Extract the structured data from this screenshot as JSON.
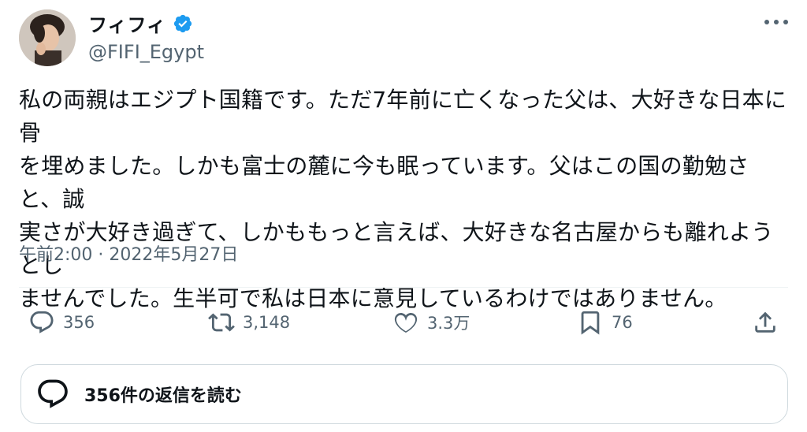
{
  "author": {
    "display_name": "フィフィ",
    "handle": "@FIFI_Egypt",
    "verified": true,
    "verified_color": "#1d9bf0"
  },
  "tweet": {
    "text": "私の両親はエジプト国籍です。ただ7年前に亡くなった父は、大好きな日本に骨\nを埋めました。しかも富士の麓に今も眠っています。父はこの国の勤勉さと、誠\n実さが大好き過ぎて、しかももっと言えば、大好きな名古屋からも離れようとし\nませんでした。生半可で私は日本に意見しているわけではありません。",
    "timestamp": "午前2:00 · 2022年5月27日"
  },
  "actions": {
    "reply_count": "356",
    "retweet_count": "3,148",
    "like_count": "3.3万",
    "bookmark_count": "76"
  },
  "replies_button": {
    "label": "356件の返信を読む"
  },
  "icons": {
    "reply": "speech-bubble-icon",
    "retweet": "retweet-icon",
    "like": "heart-icon",
    "bookmark": "bookmark-icon",
    "share": "share-upload-icon",
    "more": "more-horizontal-icon",
    "verified": "verified-badge-icon"
  }
}
